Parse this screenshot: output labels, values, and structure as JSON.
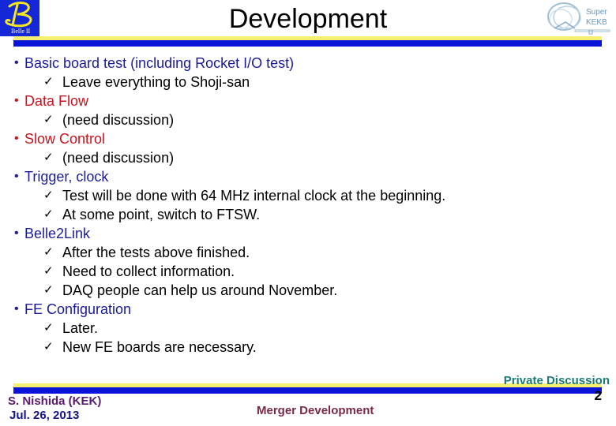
{
  "header": {
    "title": "Development",
    "left_logo": {
      "name": "belle2-logo-icon",
      "glyph": "B",
      "subtext": "Belle II"
    },
    "right_logo": {
      "name": "superkekb-logo-icon",
      "line1": "Super",
      "line2": "KEKB"
    }
  },
  "colors": {
    "accent_blue": "#0a14d8",
    "accent_yellow": "#f5f070",
    "bullet_blue": "#1a1a9a",
    "bullet_red": "#c8141e"
  },
  "content": {
    "items": [
      {
        "text": "Basic board test (including Rocket I/O test)",
        "color": "blue",
        "subitems": [
          "Leave everything to Shoji-san"
        ]
      },
      {
        "text": "Data Flow",
        "color": "red",
        "subitems": [
          "(need discussion)"
        ]
      },
      {
        "text": "Slow Control",
        "color": "red",
        "subitems": [
          "(need discussion)"
        ]
      },
      {
        "text": "Trigger, clock",
        "color": "blue",
        "subitems": [
          "Test will be done with 64 MHz internal clock at the beginning.",
          "At some point, switch to FTSW."
        ]
      },
      {
        "text": "Belle2Link",
        "color": "blue",
        "subitems": [
          "After the tests above finished.",
          "Need to collect information.",
          "DAQ people can help us around November."
        ]
      },
      {
        "text": "FE Configuration",
        "color": "blue",
        "subitems": [
          "Later.",
          "New FE boards are necessary."
        ]
      }
    ],
    "bullet": "•",
    "check": "✓"
  },
  "footer": {
    "author": "S. Nishida (KEK)",
    "date": "Jul. 26,  2013",
    "center": "Merger Development",
    "confidentiality": "Private Discussion",
    "page_number": "2"
  }
}
